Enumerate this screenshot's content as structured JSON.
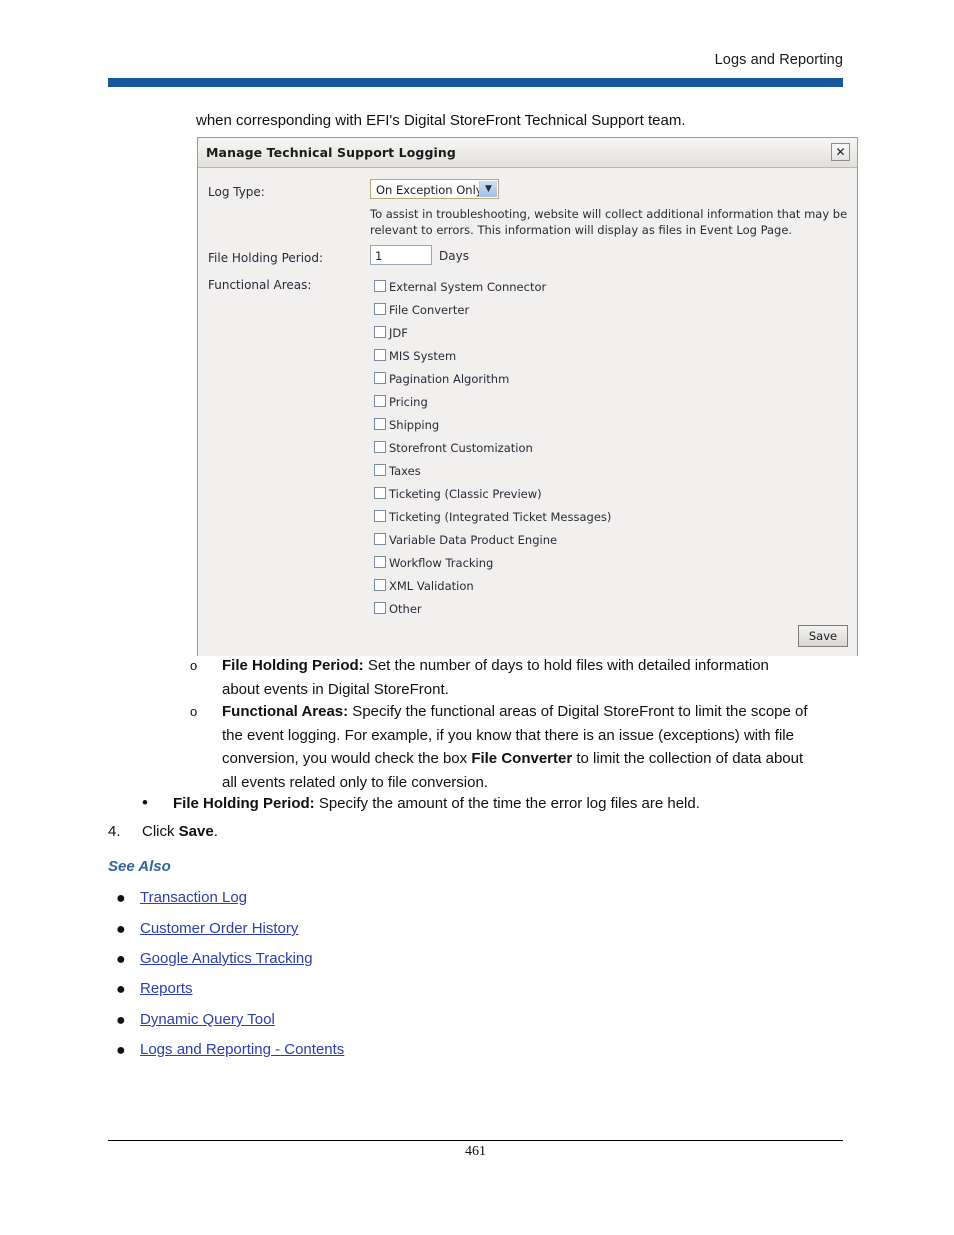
{
  "page": {
    "running_header": "Logs and Reporting",
    "page_number": "461",
    "accent_color": "#15599b",
    "link_color": "#2a3fb0",
    "see_also_color": "#31659c"
  },
  "intro": {
    "line": "when corresponding with EFI's Digital StoreFront Technical Support team."
  },
  "dialog": {
    "title": "Manage Technical Support Logging",
    "close_icon": "close-icon",
    "close_glyph": "✕",
    "log_type": {
      "label": "Log Type:",
      "value": "On Exception Only",
      "arrow_glyph": "▼"
    },
    "help_text": "To assist in troubleshooting, website will collect additional information that may be relevant to errors. This information will display as files in Event Log Page.",
    "file_holding_period": {
      "label": "File Holding Period:",
      "value": "1",
      "unit": "Days"
    },
    "functional_areas": {
      "label": "Functional Areas:",
      "options": [
        {
          "label": "External System Connector",
          "checked": false
        },
        {
          "label": "File Converter",
          "checked": false
        },
        {
          "label": "JDF",
          "checked": false
        },
        {
          "label": "MIS System",
          "checked": false
        },
        {
          "label": "Pagination Algorithm",
          "checked": false
        },
        {
          "label": "Pricing",
          "checked": false
        },
        {
          "label": "Shipping",
          "checked": false
        },
        {
          "label": "Storefront Customization",
          "checked": false
        },
        {
          "label": "Taxes",
          "checked": false
        },
        {
          "label": "Ticketing (Classic Preview)",
          "checked": false
        },
        {
          "label": "Ticketing (Integrated Ticket Messages)",
          "checked": false
        },
        {
          "label": "Variable Data Product Engine",
          "checked": false
        },
        {
          "label": "Workflow Tracking",
          "checked": false
        },
        {
          "label": "XML Validation",
          "checked": false
        },
        {
          "label": "Other",
          "checked": false
        }
      ]
    },
    "save_label": "Save"
  },
  "outline": {
    "sub_bullet_marker": "o",
    "item1": {
      "term": "File Holding Period:",
      "line1": " Set the number of days to hold files with detailed information",
      "line2": "about events in Digital StoreFront."
    },
    "item2": {
      "term": "Functional Areas:",
      "line1": " Specify the functional areas of Digital StoreFront to limit the scope of",
      "line2": "the event logging. For example, if you know that there is an issue (exceptions) with file",
      "line3_a": "conversion, you would check the box ",
      "line3_bold": "File Converter",
      "line3_b": " to limit the collection of data about",
      "line4": "all events related only to file conversion."
    },
    "level1": {
      "bullet": "•",
      "term": "File Holding Period:",
      "text": " Specify the amount of the time the error log files are held."
    },
    "step4": {
      "marker": "4.",
      "text_a": "Click ",
      "text_bold": "Save",
      "text_b": "."
    }
  },
  "see_also": {
    "heading": "See Also",
    "bullet": "●",
    "links": [
      "Transaction Log",
      "Customer Order History",
      "Google Analytics Tracking",
      "Reports",
      "Dynamic Query Tool",
      "Logs and Reporting - Contents"
    ]
  }
}
